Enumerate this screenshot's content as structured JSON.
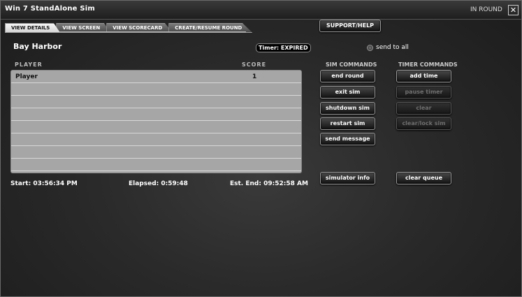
{
  "window": {
    "title": "Win 7 StandAlone Sim",
    "status": "IN ROUND",
    "close_glyph": "✕"
  },
  "tabs": [
    {
      "label": "VIEW DETAILS",
      "active": true
    },
    {
      "label": "VIEW SCREEN",
      "active": false
    },
    {
      "label": "VIEW SCORECARD",
      "active": false
    },
    {
      "label": "CREATE/RESUME ROUND",
      "active": false
    }
  ],
  "support_button": "SUPPORT/HELP",
  "course_name": "Bay Harbor",
  "timer_status": "Timer: EXPIRED",
  "send_to_all_label": "send to all",
  "table": {
    "headers": {
      "player": "PLAYER",
      "score": "SCORE"
    },
    "rows": [
      {
        "player": "Player",
        "score": "1"
      },
      {
        "player": "",
        "score": ""
      },
      {
        "player": "",
        "score": ""
      },
      {
        "player": "",
        "score": ""
      },
      {
        "player": "",
        "score": ""
      },
      {
        "player": "",
        "score": ""
      },
      {
        "player": "",
        "score": ""
      },
      {
        "player": "",
        "score": ""
      }
    ]
  },
  "footer": {
    "start": "Start: 03:56:34 PM",
    "elapsed": "Elapsed: 0:59:48",
    "est_end": "Est. End: 09:52:58 AM"
  },
  "sim_commands": {
    "heading": "SIM COMMANDS",
    "buttons": [
      "end round",
      "exit sim",
      "shutdown sim",
      "restart sim",
      "send message"
    ],
    "info_button": "simulator info"
  },
  "timer_commands": {
    "heading": "TIMER COMMANDS",
    "buttons": [
      {
        "label": "add time",
        "enabled": true
      },
      {
        "label": "pause timer",
        "enabled": false
      },
      {
        "label": "clear",
        "enabled": false
      },
      {
        "label": "clear/lock sim",
        "enabled": false
      }
    ],
    "queue_button": "clear queue"
  },
  "icons": {
    "close": "close-icon",
    "radio": "radio-icon"
  }
}
